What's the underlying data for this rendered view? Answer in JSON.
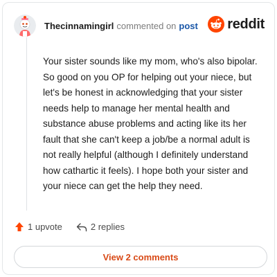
{
  "comment": {
    "username": "Thecinnamingirl",
    "commented_on": "commented on",
    "post_link": "post",
    "body": "Your sister sounds like my mom, who's also bipolar. So good on you OP for helping out your niece, but let's be honest in acknowledging that your sister needs help to manage her mental health and substance abuse problems and acting like its her fault that she can't keep a job/be a normal adult is not really helpful (although I definitely understand how cathartic it feels). I hope both your sister and your niece can get the help they need."
  },
  "brand": {
    "name": "reddit",
    "icon": "reddit-logo-icon",
    "color": "#ff4500"
  },
  "actions": {
    "upvote_label": "1 upvote",
    "upvote_icon": "upvote-arrow-icon",
    "replies_label": "2 replies",
    "replies_icon": "reply-arrow-icon"
  },
  "view_comments_label": "View 2 comments",
  "colors": {
    "accent": "#d84a17",
    "link": "#1a57a8",
    "upvote": "#ff4500"
  }
}
